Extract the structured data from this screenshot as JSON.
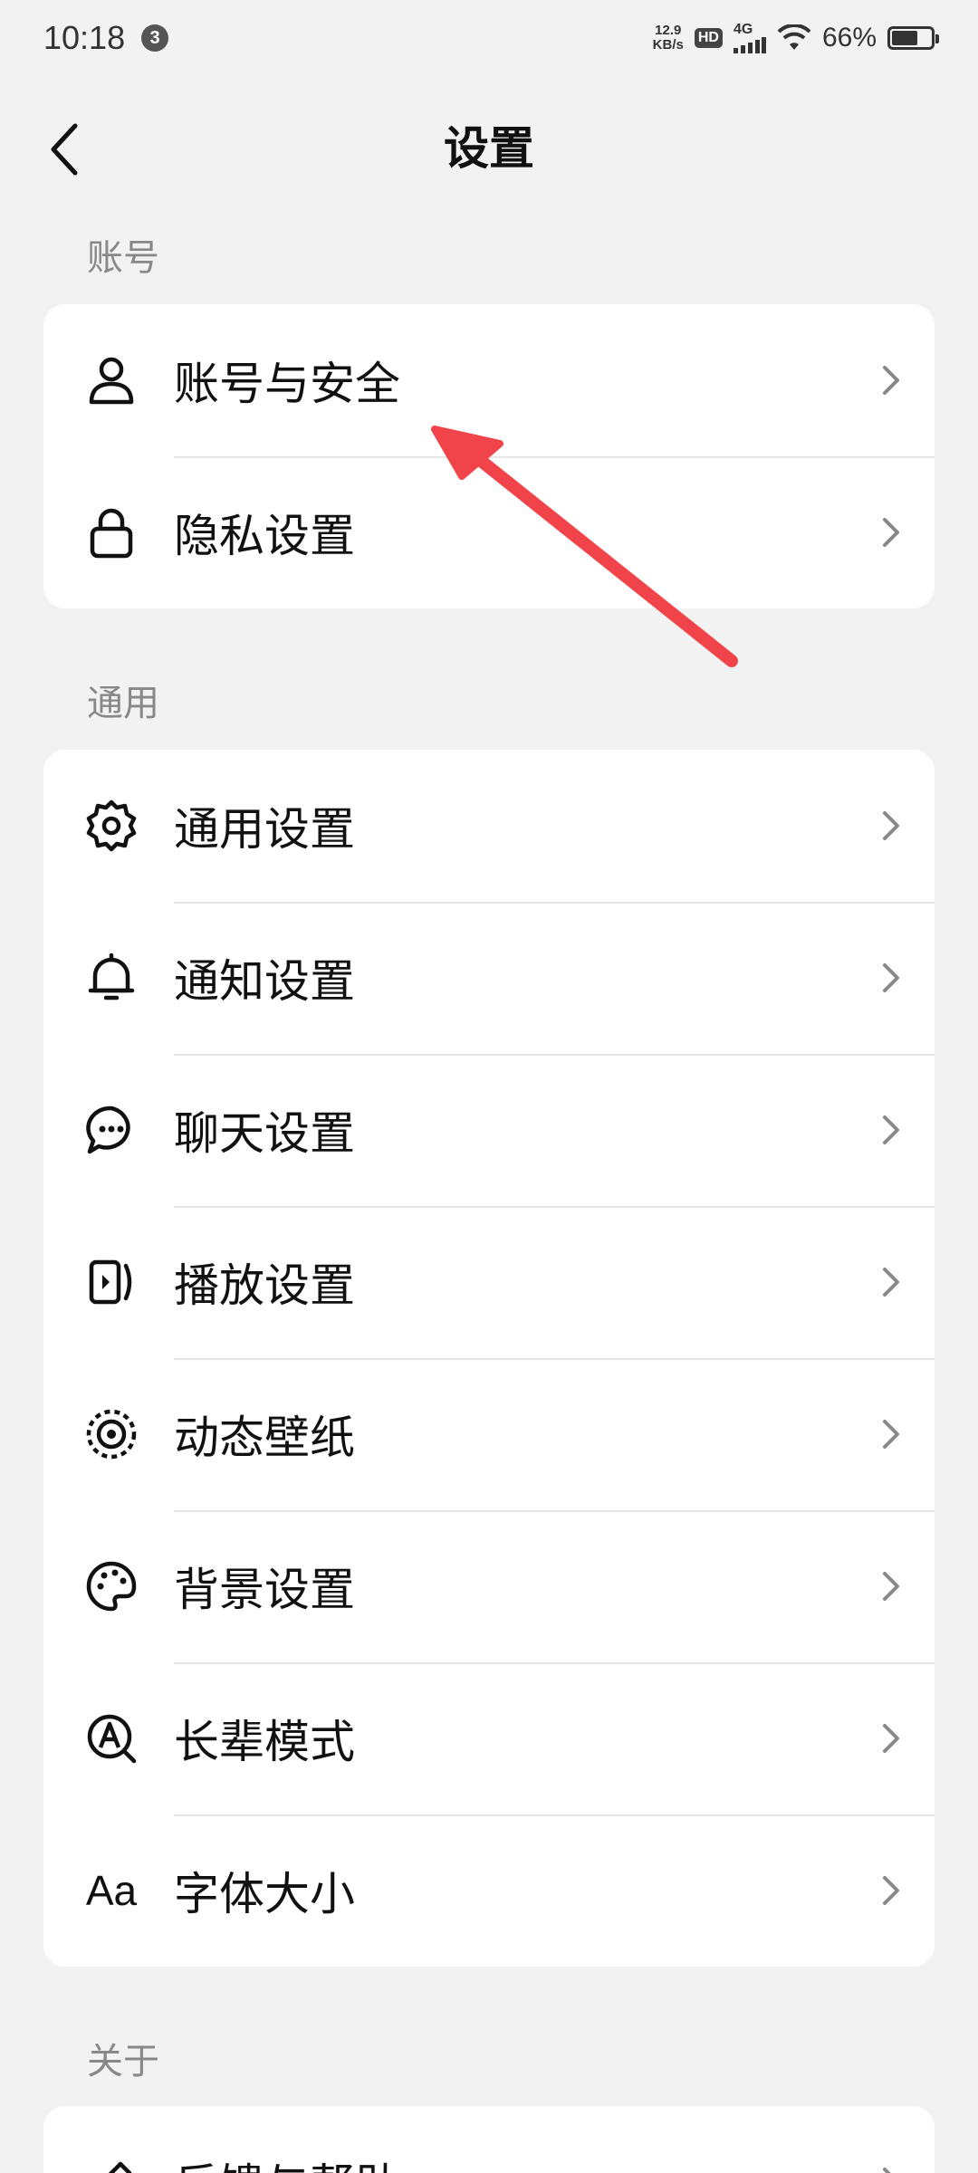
{
  "status_bar": {
    "time": "10:18",
    "notification_count": "3",
    "net_speed_value": "12.9",
    "net_speed_unit": "KB/s",
    "hd": "HD",
    "network_type": "4G",
    "battery_percent": "66%",
    "battery_level": 0.66
  },
  "header": {
    "title": "设置",
    "back_icon": "chevron-left-icon"
  },
  "sections": {
    "account": {
      "label": "账号",
      "items": [
        {
          "label": "账号与安全",
          "icon": "user-icon"
        },
        {
          "label": "隐私设置",
          "icon": "lock-icon"
        }
      ]
    },
    "general": {
      "label": "通用",
      "items": [
        {
          "label": "通用设置",
          "icon": "gear-icon"
        },
        {
          "label": "通知设置",
          "icon": "bell-icon"
        },
        {
          "label": "聊天设置",
          "icon": "chat-bubble-icon"
        },
        {
          "label": "播放设置",
          "icon": "play-icon"
        },
        {
          "label": "动态壁纸",
          "icon": "live-wallpaper-icon"
        },
        {
          "label": "背景设置",
          "icon": "palette-icon"
        },
        {
          "label": "长辈模式",
          "icon": "elder-mode-icon"
        },
        {
          "label": "字体大小",
          "icon": "font-size-icon",
          "icon_text": "Aa"
        }
      ]
    },
    "about": {
      "label": "关于",
      "items": [
        {
          "label": "反馈与帮助",
          "icon": "feedback-icon"
        }
      ]
    }
  },
  "colors": {
    "background": "#f2f2f2",
    "card": "#ffffff",
    "annotation_arrow": "#f0444a"
  }
}
